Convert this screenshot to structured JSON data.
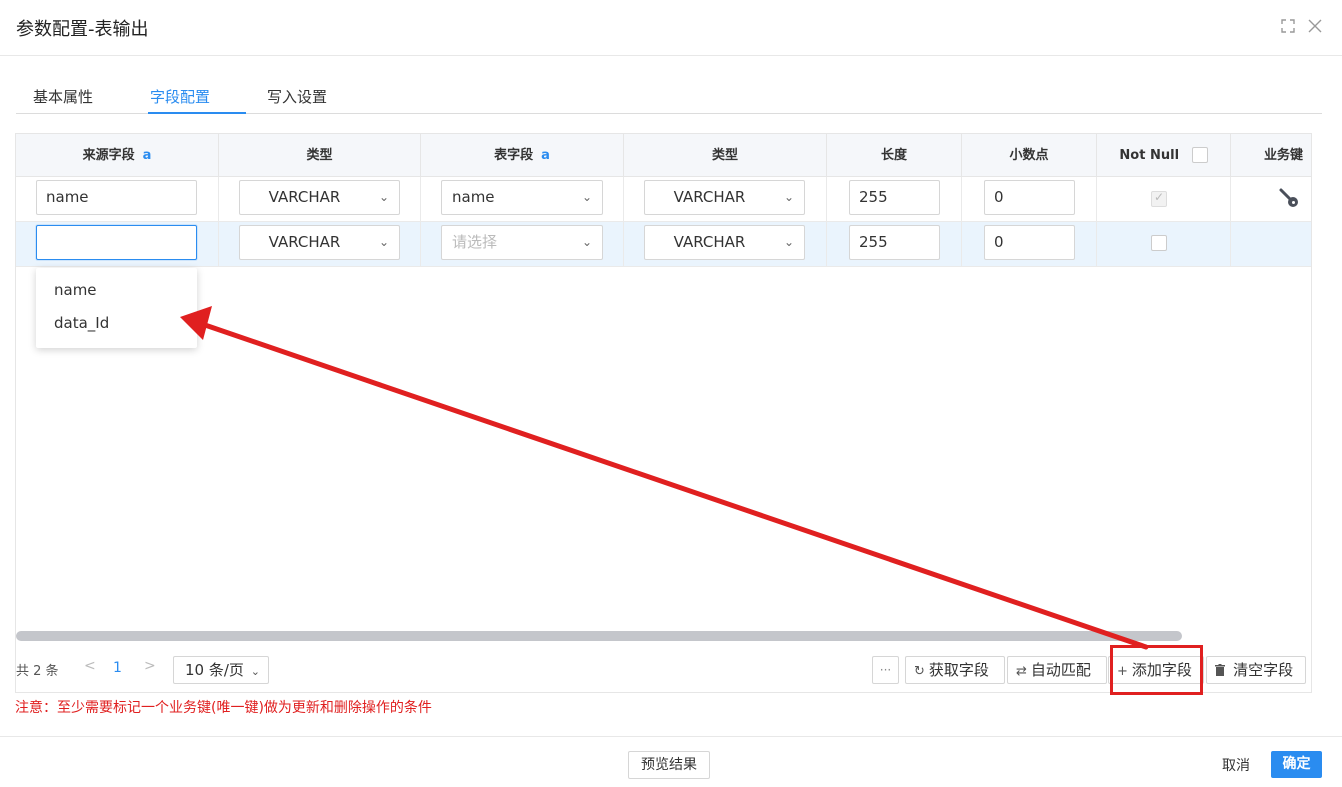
{
  "dialog": {
    "title": "参数配置-表输出",
    "fullscreen_icon": "expand-icon",
    "close_icon": "close-icon"
  },
  "tabs": [
    {
      "label": "基本属性",
      "active": false
    },
    {
      "label": "字段配置",
      "active": true
    },
    {
      "label": "写入设置",
      "active": false
    }
  ],
  "table": {
    "columns": [
      {
        "label": "来源字段",
        "mark": "a"
      },
      {
        "label": "类型",
        "mark": ""
      },
      {
        "label": "表字段",
        "mark": "a"
      },
      {
        "label": "类型",
        "mark": ""
      },
      {
        "label": "长度",
        "mark": ""
      },
      {
        "label": "小数点",
        "mark": ""
      },
      {
        "label": "Not Null",
        "mark": ""
      },
      {
        "label": "业务键",
        "mark": ""
      }
    ],
    "rows": [
      {
        "source_field": "name",
        "source_type": "VARCHAR",
        "table_field": "name",
        "table_field_placeholder": "",
        "table_type": "VARCHAR",
        "length": "255",
        "decimal": "0",
        "not_null": "checked-disabled",
        "business_key_icon": "key-icon"
      },
      {
        "source_field": "",
        "source_type": "VARCHAR",
        "table_field": "",
        "table_field_placeholder": "请选择",
        "table_type": "VARCHAR",
        "length": "255",
        "decimal": "0",
        "not_null": "unchecked",
        "business_key_icon": ""
      }
    ],
    "dropdown_options": [
      "name",
      "data_Id"
    ]
  },
  "pager": {
    "total": "共 2 条",
    "prev": "<",
    "page": "1",
    "next": ">",
    "page_size": "10 条/页"
  },
  "toolbar": {
    "more": "···",
    "fetch_fields": "获取字段",
    "auto_match": "自动匹配",
    "add_field": "添加字段",
    "clear_fields": "清空字段"
  },
  "note": "注意：至少需要标记一个业务键(唯一键)做为更新和删除操作的条件",
  "footer": {
    "preview": "预览结果",
    "cancel": "取消",
    "ok": "确定"
  },
  "colors": {
    "accent": "#2a8cf0",
    "annotation_red": "#e02020"
  }
}
